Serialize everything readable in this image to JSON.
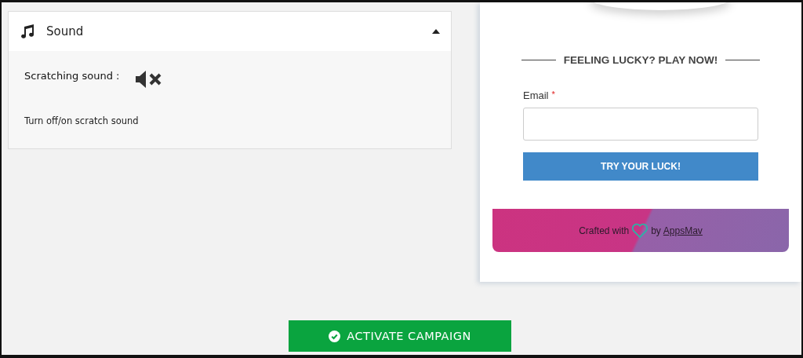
{
  "sound_panel": {
    "title": "Sound",
    "expanded": true,
    "setting_label": "Scratching sound :",
    "muted": true,
    "help_text": "Turn off/on scratch sound"
  },
  "game_card": {
    "heading": "FEELING LUCKY? PLAY NOW!",
    "email_label": "Email",
    "required_mark": "*",
    "submit_button": "TRY YOUR LUCK!",
    "footer": {
      "prefix": "Crafted with",
      "middle": "by",
      "link": "AppsMav"
    }
  },
  "activate_button": "ACTIVATE CAMPAIGN"
}
